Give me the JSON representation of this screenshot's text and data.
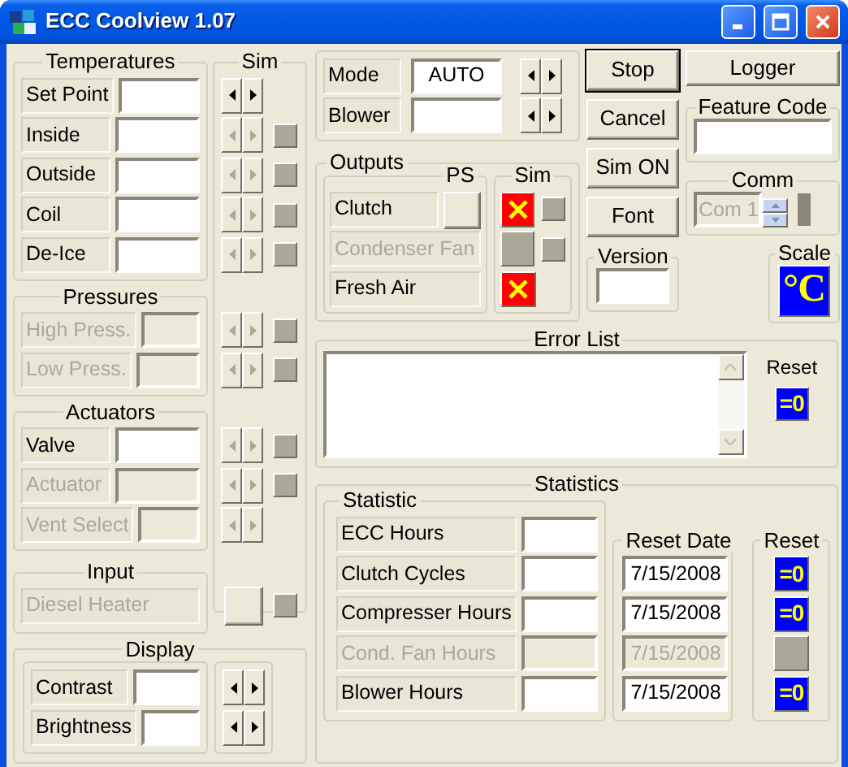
{
  "window": {
    "title": "ECC Coolview 1.07"
  },
  "sim": {
    "title": "Sim"
  },
  "groups": [
    {
      "title": "Temperatures",
      "rows": [
        {
          "kind": "field",
          "label": "Set Point",
          "disabled": false,
          "sim": {
            "kind": "spinner",
            "disabled": false,
            "indicator": false
          }
        },
        {
          "kind": "field",
          "label": "Inside",
          "disabled": false,
          "sim": {
            "kind": "spinner",
            "disabled": true,
            "indicator": true
          }
        },
        {
          "kind": "field",
          "label": "Outside",
          "disabled": false,
          "sim": {
            "kind": "spinner",
            "disabled": true,
            "indicator": true
          }
        },
        {
          "kind": "field",
          "label": "Coil",
          "disabled": false,
          "sim": {
            "kind": "spinner",
            "disabled": true,
            "indicator": true
          }
        },
        {
          "kind": "field",
          "label": "De-Ice",
          "disabled": false,
          "sim": {
            "kind": "spinner",
            "disabled": true,
            "indicator": true
          }
        }
      ]
    },
    {
      "title": "Pressures",
      "rows": [
        {
          "kind": "field",
          "label": "High Press.",
          "disabled": true,
          "sim": {
            "kind": "spinner",
            "disabled": true,
            "indicator": true
          }
        },
        {
          "kind": "field",
          "label": "Low Press.",
          "disabled": true,
          "sim": {
            "kind": "spinner",
            "disabled": true,
            "indicator": true
          }
        }
      ]
    },
    {
      "title": "Actuators",
      "rows": [
        {
          "kind": "field",
          "label": "Valve",
          "disabled": false,
          "sim": {
            "kind": "spinner",
            "disabled": true,
            "indicator": true
          }
        },
        {
          "kind": "field",
          "label": "Actuator",
          "disabled": true,
          "sim": {
            "kind": "spinner",
            "disabled": true,
            "indicator": true
          }
        },
        {
          "kind": "field",
          "label": "Vent Select",
          "disabled": true,
          "sim": {
            "kind": "spinner",
            "disabled": true,
            "indicator": false
          }
        }
      ]
    },
    {
      "title": "Input",
      "rows": [
        {
          "kind": "label",
          "label": "Diesel Heater",
          "disabled": true,
          "sim": {
            "kind": "button",
            "disabled": false,
            "indicator": true
          }
        }
      ]
    }
  ],
  "display": {
    "title": "Display",
    "rows": [
      {
        "label": "Contrast",
        "disabled": false
      },
      {
        "label": "Brightness",
        "disabled": false
      }
    ]
  },
  "mode_panel": {
    "rows": [
      {
        "label": "Mode",
        "value": "AUTO",
        "disabled": false
      },
      {
        "label": "Blower",
        "disabled": false
      }
    ]
  },
  "outputs": {
    "title": "Outputs",
    "ps_title": "PS",
    "sim_title": "Sim",
    "rows": [
      {
        "label": "Clutch",
        "disabled": false,
        "ps_button": true,
        "sim": {
          "checked": true,
          "indicator": true
        }
      },
      {
        "label": "Condenser Fan",
        "disabled": true,
        "ps_button": false,
        "sim": {
          "checked": false,
          "indicator": true
        }
      },
      {
        "label": "Fresh Air",
        "disabled": false,
        "ps_button": false,
        "sim": {
          "checked": true,
          "indicator": false
        }
      }
    ]
  },
  "buttons": [
    {
      "label": "Stop",
      "default": true
    },
    {
      "label": "Cancel",
      "default": false
    },
    {
      "label": "Sim ON",
      "default": false
    },
    {
      "label": "Font",
      "default": false
    }
  ],
  "version": {
    "title": "Version"
  },
  "logger_button": {
    "label": "Logger"
  },
  "feature_code": {
    "title": "Feature Code"
  },
  "comm": {
    "title": "Comm",
    "value": "Com 1",
    "disabled": true
  },
  "scale": {
    "title": "Scale",
    "label": "°C"
  },
  "error_list": {
    "title": "Error List",
    "reset_title": "Reset",
    "reset_label": "=0"
  },
  "statistics": {
    "title": "Statistics",
    "statistic_title": "Statistic",
    "date_title": "Reset Date",
    "reset_title": "Reset",
    "rows": [
      {
        "label": "ECC Hours",
        "disabled": false
      },
      {
        "label": "Clutch Cycles",
        "disabled": false,
        "reset_date": "7/15/2008",
        "reset_label": "=0"
      },
      {
        "label": "Compresser Hours",
        "disabled": false,
        "reset_date": "7/15/2008",
        "reset_label": "=0"
      },
      {
        "label": "Cond. Fan Hours",
        "disabled": true,
        "reset_date": "7/15/2008"
      },
      {
        "label": "Blower Hours",
        "disabled": false,
        "reset_date": "7/15/2008",
        "reset_label": "=0"
      }
    ]
  }
}
